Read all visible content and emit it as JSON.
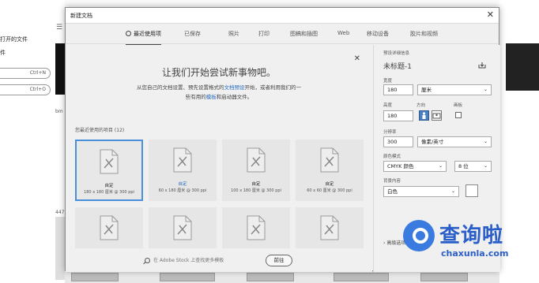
{
  "background": {
    "open_label": "打开的文件",
    "file_label": "件",
    "shortcuts": [
      "Ctrl+N",
      "Ctrl+O"
    ],
    "thumb_label_bm": "bm",
    "thumb_label_447": "447"
  },
  "dialog": {
    "title": "新建文档",
    "tabs": [
      {
        "label": "最近使用项",
        "active": true
      },
      {
        "label": "已保存"
      },
      {
        "label": "照片"
      },
      {
        "label": "打印"
      },
      {
        "label": "图稿和插图"
      },
      {
        "label": "Web"
      },
      {
        "label": "移动设备"
      },
      {
        "label": "胶片和视频"
      }
    ],
    "welcome": {
      "headline": "让我们开始尝试新事物吧。",
      "sub1_pre": "从您自己的文档设置、预先设置格式的",
      "sub1_link": "文档预设",
      "sub1_post": "开始，或者利用我们的一",
      "sub2_pre": "些有用的",
      "sub2_link": "模板",
      "sub2_post": "和启动器文件。"
    },
    "recent_label": "您最近使用的项目 (12)",
    "items": [
      {
        "name": "自定",
        "spec": "180 x 180 厘米 @ 300 ppi"
      },
      {
        "name": "自定",
        "spec": "60 x 180 厘米 @ 300 ppi"
      },
      {
        "name": "自定",
        "spec": "100 x 180 厘米 @ 300 ppi"
      },
      {
        "name": "自定",
        "spec": "60 x 60 厘米 @ 300 ppi"
      }
    ],
    "search": {
      "placeholder": "在 Adobe Stock 上查找更多模板",
      "go_label": "前往"
    }
  },
  "panel": {
    "preset_label": "预设详细信息",
    "doc_title": "未标题-1",
    "width_label": "宽度",
    "width_value": "180",
    "width_unit": "厘米",
    "height_label": "高度",
    "height_value": "180",
    "orientation_label": "方向",
    "artboard_label": "画板",
    "resolution_label": "分辨率",
    "resolution_value": "300",
    "resolution_unit": "像素/英寸",
    "color_mode_label": "颜色模式",
    "color_mode_value": "CMYK 颜色",
    "bit_depth_value": "8 位",
    "bg_label": "背景内容",
    "bg_value": "白色",
    "advanced_label": "高级选项"
  },
  "watermark": {
    "brand": "查询啦",
    "domain": "chaxunla.com"
  },
  "colors": {
    "accent": "#4a90d9",
    "link": "#2b6cc4",
    "watermark": "#2a5ec8"
  }
}
